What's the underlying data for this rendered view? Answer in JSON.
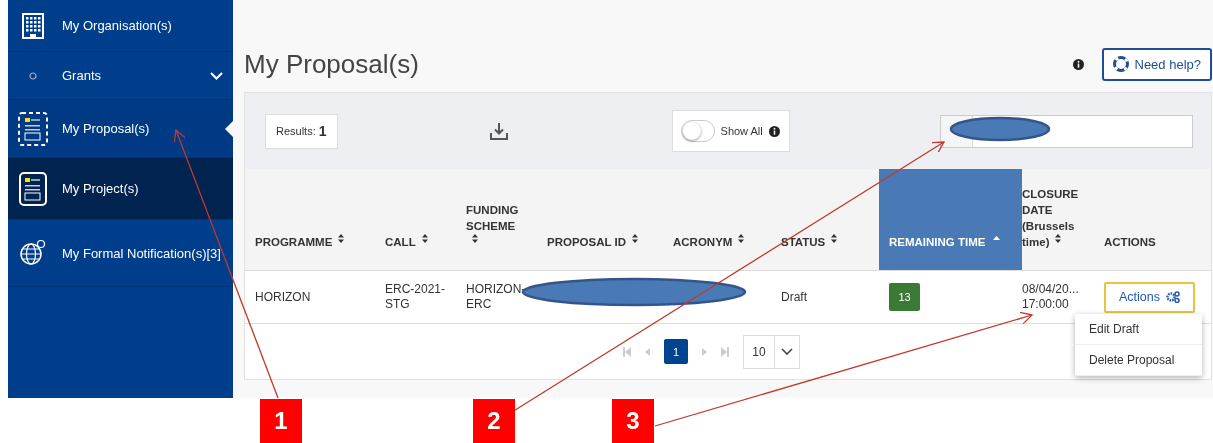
{
  "sidebar": {
    "items": [
      {
        "label": "My Organisation(s)",
        "selected": false,
        "highlighted": false
      },
      {
        "label": "Grants",
        "selected": false,
        "highlighted": false,
        "expanded": false
      },
      {
        "label": "My Proposal(s)",
        "selected": true,
        "highlighted": false
      },
      {
        "label": "My Project(s)",
        "selected": false,
        "highlighted": true
      },
      {
        "label": "My Formal Notification(s)[3]",
        "selected": false,
        "highlighted": false
      }
    ]
  },
  "page": {
    "title": "My Proposal(s)",
    "help_button": "Need help?"
  },
  "toolbar": {
    "results_label": "Results:",
    "results_count": "1",
    "show_all": {
      "label": "Show All",
      "on": false
    }
  },
  "table": {
    "columns": [
      {
        "label": "PROGRAMME",
        "kind": "sortable",
        "selected": false
      },
      {
        "label": "CALL",
        "kind": "sortable",
        "selected": false
      },
      {
        "label": "FUNDING SCHEME",
        "kind": "sortable",
        "selected": false
      },
      {
        "label": "PROPOSAL ID",
        "kind": "sortable",
        "selected": false
      },
      {
        "label": "ACRONYM",
        "kind": "sortable",
        "selected": false
      },
      {
        "label": "STATUS",
        "kind": "sortable",
        "selected": false
      },
      {
        "label": "REMAINING TIME",
        "kind": "ascending",
        "selected": true
      },
      {
        "label": "CLOSURE DATE (Brussels time)",
        "kind": "sortable",
        "selected": false
      },
      {
        "label": "ACTIONS",
        "kind": "plain",
        "selected": false
      }
    ],
    "rows": [
      {
        "programme": "HORIZON",
        "call": "ERC-2021-STG",
        "funding_scheme": "HORIZON-ERC",
        "status": "Draft",
        "remaining_time": "13",
        "closure_date": [
          "08/04/20...",
          "17:00:00"
        ],
        "actions": "Actions"
      }
    ]
  },
  "actions_menu": [
    "Edit Draft",
    "Delete Proposal"
  ],
  "pagination": {
    "pages": [
      {
        "label": "1",
        "selected": true
      }
    ],
    "page_size": "10"
  },
  "callouts": [
    "1",
    "2",
    "3"
  ]
}
